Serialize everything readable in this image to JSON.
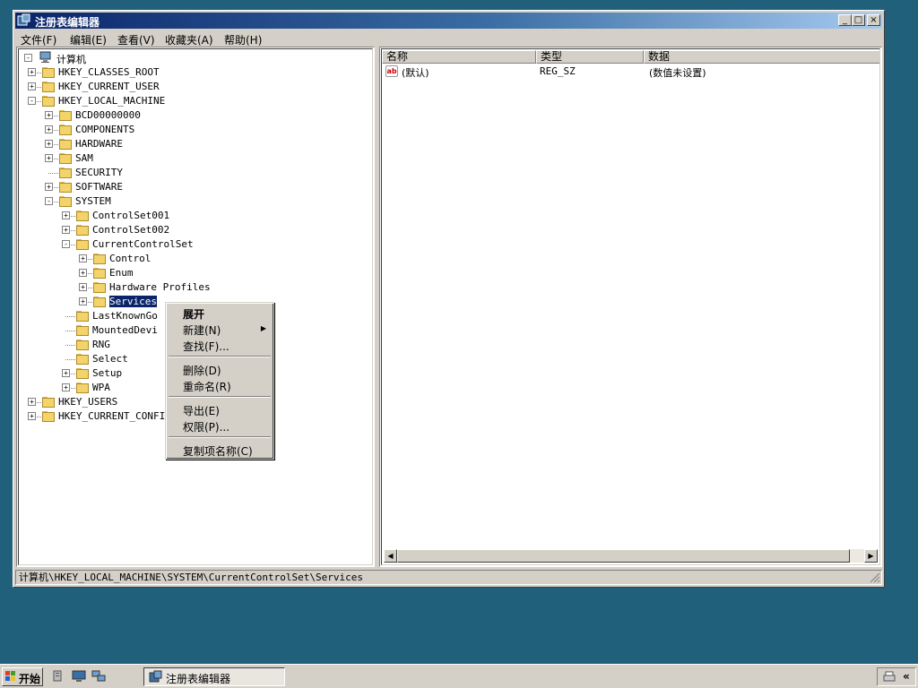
{
  "window": {
    "title": "注册表编辑器",
    "minimize": "_",
    "maximize": "□",
    "close": "×"
  },
  "menubar": [
    "文件(F)",
    "编辑(E)",
    "查看(V)",
    "收藏夹(A)",
    "帮助(H)"
  ],
  "tree": {
    "root": "计算机",
    "nodes": [
      {
        "label": "HKEY_CLASSES_ROOT",
        "expander": "+"
      },
      {
        "label": "HKEY_CURRENT_USER",
        "expander": "+"
      },
      {
        "label": "HKEY_LOCAL_MACHINE",
        "expander": "-"
      },
      {
        "label": "BCD00000000",
        "expander": "+"
      },
      {
        "label": "COMPONENTS",
        "expander": "+"
      },
      {
        "label": "HARDWARE",
        "expander": "+"
      },
      {
        "label": "SAM",
        "expander": "+"
      },
      {
        "label": "SECURITY",
        "expander": ""
      },
      {
        "label": "SOFTWARE",
        "expander": "+"
      },
      {
        "label": "SYSTEM",
        "expander": "-"
      },
      {
        "label": "ControlSet001",
        "expander": "+"
      },
      {
        "label": "ControlSet002",
        "expander": "+"
      },
      {
        "label": "CurrentControlSet",
        "expander": "-"
      },
      {
        "label": "Control",
        "expander": "+"
      },
      {
        "label": "Enum",
        "expander": "+"
      },
      {
        "label": "Hardware Profiles",
        "expander": "+"
      },
      {
        "label": "Services",
        "expander": "+",
        "selected": true
      },
      {
        "label": "LastKnownGo",
        "expander": ""
      },
      {
        "label": "MountedDevi",
        "expander": ""
      },
      {
        "label": "RNG",
        "expander": ""
      },
      {
        "label": "Select",
        "expander": ""
      },
      {
        "label": "Setup",
        "expander": "+"
      },
      {
        "label": "WPA",
        "expander": "+"
      },
      {
        "label": "HKEY_USERS",
        "expander": "+"
      },
      {
        "label": "HKEY_CURRENT_CONFI",
        "expander": "+"
      }
    ]
  },
  "list": {
    "headers": {
      "name": "名称",
      "type": "类型",
      "data": "数据"
    },
    "rows": [
      {
        "icon": "ab",
        "name": "(默认)",
        "type": "REG_SZ",
        "data": "(数值未设置)"
      }
    ]
  },
  "context_menu": {
    "expand": "展开",
    "new": "新建(N)",
    "find": "查找(F)...",
    "delete": "删除(D)",
    "rename": "重命名(R)",
    "export": "导出(E)",
    "permissions": "权限(P)...",
    "copy_key_name": "复制项名称(C)"
  },
  "statusbar": "计算机\\HKEY_LOCAL_MACHINE\\SYSTEM\\CurrentControlSet\\Services",
  "taskbar": {
    "start": "开始",
    "task": "注册表编辑器",
    "tray_arrow": "«"
  },
  "colors": {
    "desktop": "#21607a",
    "titlebar_start": "#0a246a",
    "titlebar_end": "#a6caf0",
    "selection": "#0a246a",
    "face": "#d4d0c8"
  }
}
